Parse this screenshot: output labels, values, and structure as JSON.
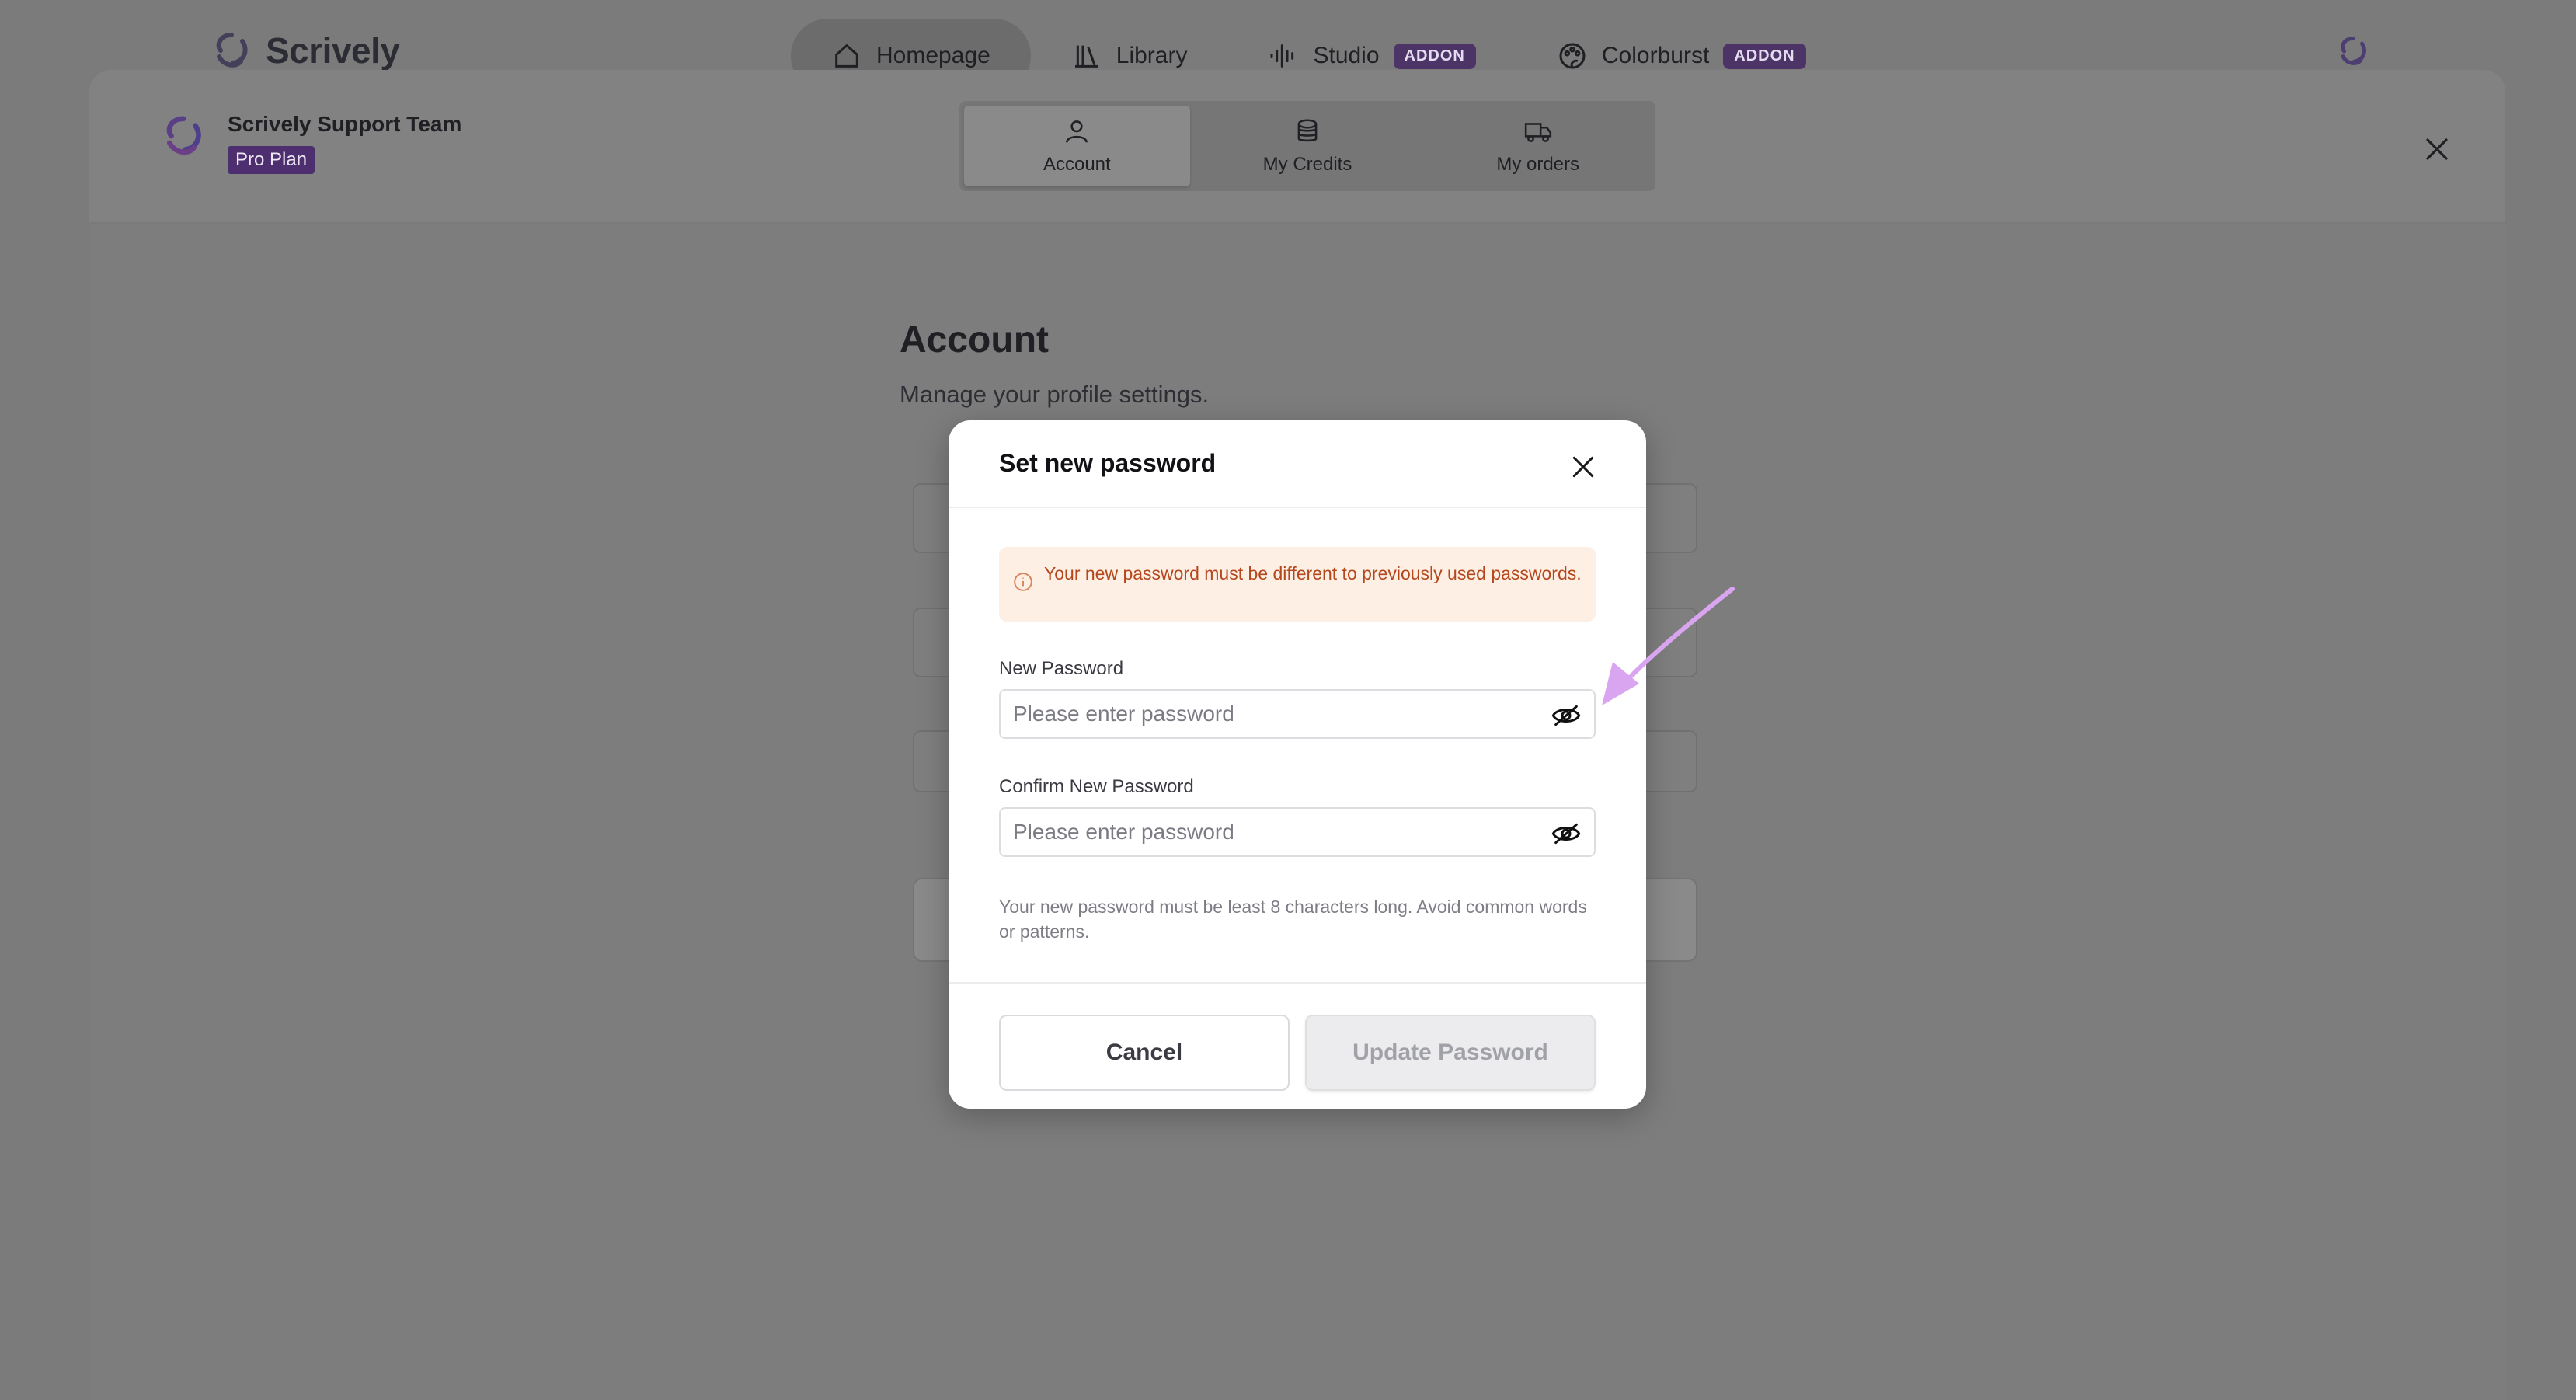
{
  "app": {
    "brand_name": "Scrively",
    "nav": [
      {
        "label": "Homepage",
        "icon": "home-icon",
        "active": true
      },
      {
        "label": "Library",
        "icon": "library-icon"
      },
      {
        "label": "Studio",
        "icon": "waveform-icon",
        "badge": "ADDON"
      },
      {
        "label": "Colorburst",
        "icon": "palette-icon",
        "badge": "ADDON"
      }
    ]
  },
  "settings": {
    "team_name": "Scrively Support Team",
    "plan": "Pro Plan",
    "tabs": [
      {
        "label": "Account",
        "icon": "user-icon",
        "active": true
      },
      {
        "label": "My Credits",
        "icon": "coins-icon"
      },
      {
        "label": "My orders",
        "icon": "truck-icon"
      }
    ],
    "page_title": "Account",
    "page_subtitle": "Manage your profile settings."
  },
  "dialog": {
    "title": "Set new password",
    "notice": "Your new password must be different to previously used passwords.",
    "new_password_label": "New Password",
    "new_password_placeholder": "Please enter password",
    "confirm_password_label": "Confirm New Password",
    "confirm_password_placeholder": "Please enter password",
    "hint": "Your new password must be least 8 characters long. Avoid common words or patterns.",
    "cancel_label": "Cancel",
    "update_label": "Update Password"
  },
  "colors": {
    "accent_purple": "#4d2e6e",
    "notice_bg": "#fdefe4",
    "notice_text": "#b5471d",
    "annotation_arrow": "#d9a4f0"
  }
}
